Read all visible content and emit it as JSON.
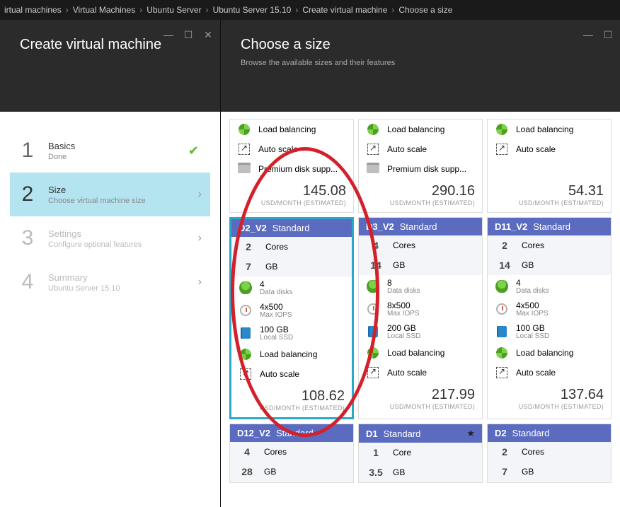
{
  "breadcrumb": [
    "irtual machines",
    "Virtual Machines",
    "Ubuntu Server",
    "Ubuntu Server 15.10",
    "Create virtual machine",
    "Choose a size"
  ],
  "left_panel": {
    "title": "Create virtual machine",
    "steps": [
      {
        "num": "1",
        "name": "Basics",
        "desc": "Done",
        "state": "done"
      },
      {
        "num": "2",
        "name": "Size",
        "desc": "Choose virtual machine size",
        "state": "active"
      },
      {
        "num": "3",
        "name": "Settings",
        "desc": "Configure optional features",
        "state": "disabled"
      },
      {
        "num": "4",
        "name": "Summary",
        "desc": "Ubuntu Server 15.10",
        "state": "disabled"
      }
    ]
  },
  "right_panel": {
    "title": "Choose a size",
    "subtitle": "Browse the available sizes and their features",
    "price_sub": "USD/MONTH (ESTIMATED)",
    "partial_row": [
      {
        "load_balancing": "Load balancing",
        "auto_scale": "Auto scale",
        "premium": "Premium disk supp...",
        "price": "145.08"
      },
      {
        "load_balancing": "Load balancing",
        "auto_scale": "Auto scale",
        "premium": "Premium disk supp...",
        "price": "290.16"
      },
      {
        "load_balancing": "Load balancing",
        "auto_scale": "Auto scale",
        "premium": null,
        "price": "54.31"
      }
    ],
    "cards": [
      {
        "sku": "D2_V2",
        "tier": "Standard",
        "cores": "2",
        "cores_label": "Cores",
        "ram": "7",
        "ram_label": "GB",
        "disks": "4",
        "disks_label": "Data disks",
        "iops": "4x500",
        "iops_label": "Max IOPS",
        "ssd": "100 GB",
        "ssd_label": "Local SSD",
        "lb": "Load balancing",
        "as": "Auto scale",
        "price": "108.62",
        "selected": true
      },
      {
        "sku": "D3_V2",
        "tier": "Standard",
        "cores": "4",
        "cores_label": "Cores",
        "ram": "14",
        "ram_label": "GB",
        "disks": "8",
        "disks_label": "Data disks",
        "iops": "8x500",
        "iops_label": "Max IOPS",
        "ssd": "200 GB",
        "ssd_label": "Local SSD",
        "lb": "Load balancing",
        "as": "Auto scale",
        "price": "217.99",
        "selected": false
      },
      {
        "sku": "D11_V2",
        "tier": "Standard",
        "cores": "2",
        "cores_label": "Cores",
        "ram": "14",
        "ram_label": "GB",
        "disks": "4",
        "disks_label": "Data disks",
        "iops": "4x500",
        "iops_label": "Max IOPS",
        "ssd": "100 GB",
        "ssd_label": "Local SSD",
        "lb": "Load balancing",
        "as": "Auto scale",
        "price": "137.64",
        "selected": false
      }
    ],
    "bottom_row": [
      {
        "sku": "D12_V2",
        "tier": "Standard",
        "cores": "4",
        "cores_label": "Cores",
        "ram": "28",
        "ram_label": "GB",
        "starred": false
      },
      {
        "sku": "D1",
        "tier": "Standard",
        "cores": "1",
        "cores_label": "Core",
        "ram": "3.5",
        "ram_label": "GB",
        "starred": true
      },
      {
        "sku": "D2",
        "tier": "Standard",
        "cores": "2",
        "cores_label": "Cores",
        "ram": "7",
        "ram_label": "GB",
        "starred": false
      }
    ]
  }
}
